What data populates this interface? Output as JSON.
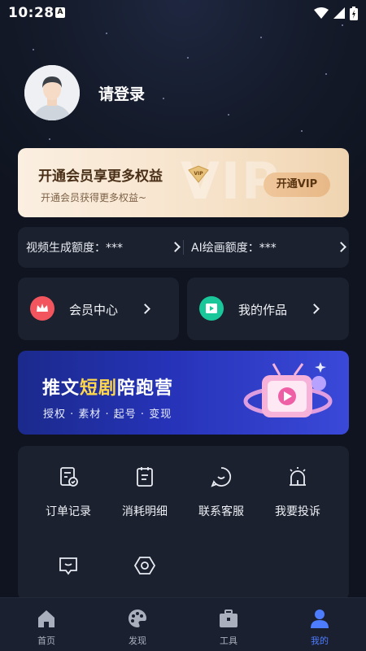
{
  "status_bar": {
    "time": "10:28",
    "notif_icon": "A"
  },
  "profile": {
    "login_prompt": "请登录"
  },
  "vip": {
    "title": "开通会员享更多权益",
    "subtitle": "开通会员获得更多权益~",
    "watermark": "VIP",
    "badge": "VIP",
    "button": "开通VIP"
  },
  "quota": {
    "video_label": "视频生成额度：***",
    "ai_label": "AI绘画额度：***"
  },
  "cards": {
    "member_center": "会员中心",
    "my_works": "我的作品"
  },
  "banner": {
    "title_pre": "推文",
    "title_hl": "短剧",
    "title_post": "陪跑营",
    "subtitle": "授权 · 素材 · 起号 · 变现"
  },
  "tools": [
    {
      "label": "订单记录",
      "icon": "order-record-icon"
    },
    {
      "label": "消耗明细",
      "icon": "consumption-detail-icon"
    },
    {
      "label": "联系客服",
      "icon": "customer-service-icon"
    },
    {
      "label": "我要投诉",
      "icon": "complaint-icon"
    },
    {
      "label": "",
      "icon": "message-icon"
    },
    {
      "label": "",
      "icon": "settings-icon"
    }
  ],
  "nav": {
    "items": [
      {
        "label": "首页",
        "icon": "home-icon"
      },
      {
        "label": "发现",
        "icon": "discover-icon"
      },
      {
        "label": "工具",
        "icon": "toolbox-icon"
      },
      {
        "label": "我的",
        "icon": "profile-icon"
      }
    ],
    "active": "我的"
  },
  "colors": {
    "accent": "#4d7cff",
    "background": "#0f1420",
    "card": "#1b212e",
    "vip_gold": "#e8b887"
  }
}
